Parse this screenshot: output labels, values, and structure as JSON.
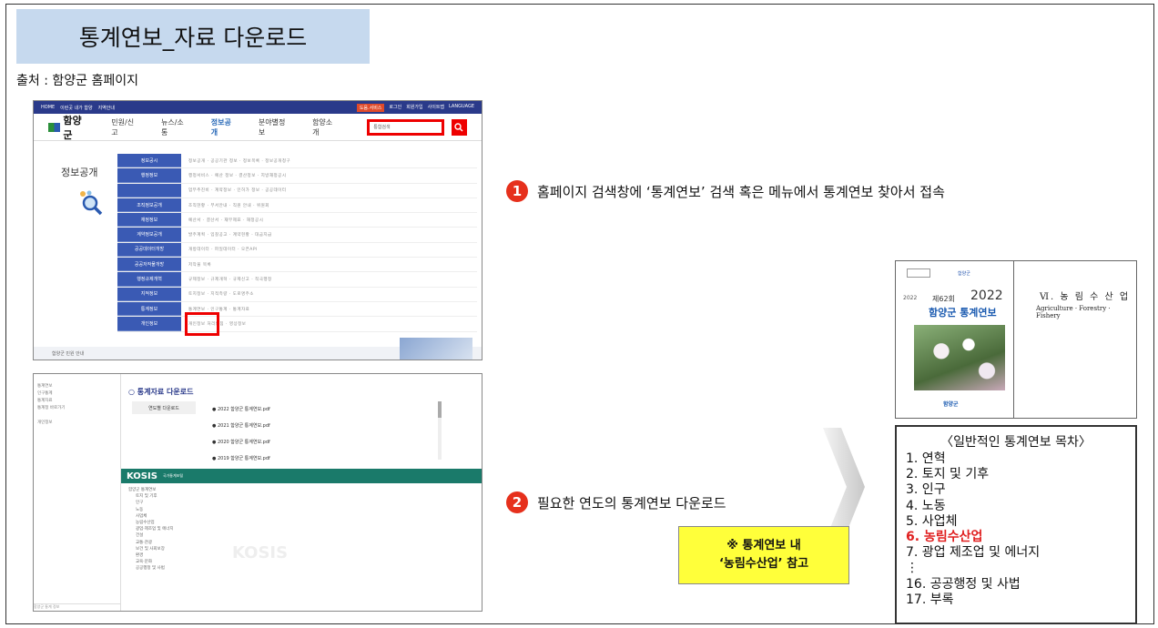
{
  "title": "통계연보_자료 다운로드",
  "source": "출처 : 함양군 홈페이지",
  "homepage": {
    "topbar_left": [
      "HOME",
      "이런곳 내가 함양",
      "지역안내"
    ],
    "topbar_right": [
      "도움.서비스",
      "로그인",
      "회원가입",
      "사이트맵",
      "LANGUAGE"
    ],
    "logo": "함양군",
    "nav": [
      "민원/신고",
      "뉴스/소통",
      "정보공개",
      "분야별정보",
      "함양소개"
    ],
    "active_nav": "정보공개",
    "search_placeholder": "통합검색",
    "search_icon": "search-icon",
    "side_title": "정보공개",
    "menu": [
      {
        "key": "정보공시",
        "val": "정보공개 · 공공기관 정보 · 정보목록 · 정보공개청구"
      },
      {
        "key": "행정정보",
        "val": "행정서비스 · 예산 정보 · 결산정보 · 지방재정공시"
      },
      {
        "key": "",
        "val": "업무추진비 · 계약정보 · 인허가 정보 · 공공데이터"
      },
      {
        "key": "조직정보공개",
        "val": "조직현황 · 부서안내 · 직원 안내 · 위원회"
      },
      {
        "key": "재정정보",
        "val": "예산서 · 결산서 · 재무제표 · 재정공시"
      },
      {
        "key": "계약정보공개",
        "val": "발주계획 · 입찰공고 · 계약현황 · 대금지급"
      },
      {
        "key": "공공데이터개방",
        "val": "개방데이터 · 파일데이터 · 오픈API"
      },
      {
        "key": "공공저작물개방",
        "val": "저작물 목록"
      },
      {
        "key": "행정규제개혁",
        "val": "규제정보 · 규제개혁 · 규제신고 · 적극행정"
      },
      {
        "key": "지적정보",
        "val": "토지정보 · 지적측량 · 도로명주소"
      },
      {
        "key": "통계정보",
        "val": "통계연보 · 인구통계 · 통계자료"
      },
      {
        "key": "개인정보",
        "val": "개인정보 처리방침 · 영상정보"
      }
    ],
    "bottom_notice": "함양군 민원 안내"
  },
  "download_page": {
    "heading": "○ 통계자료 다운로드",
    "year_label": "연도별 다운로드",
    "files": [
      "2022 함양군 통계연보.pdf",
      "2021 함양군 통계연보.pdf",
      "2020 함양군 통계연보.pdf",
      "2019 함양군 통계연보.pdf"
    ],
    "kosis_logo": "KOSIS",
    "kosis_sub": "국가통계포털",
    "kosis_tree": [
      "함양군 통계연보",
      "토지 및 기후",
      "인구",
      "노동",
      "사업체",
      "농림수산업",
      "광업·제조업 및 에너지",
      "건설",
      "교통·관광",
      "보건 및 사회보장",
      "환경",
      "교육·문화",
      "공공행정 및 사법"
    ],
    "left_menu": [
      "통계연보",
      "인구통계",
      "통계자료",
      "통계청 바로가기",
      "개인정보"
    ],
    "footer": "함양군 통계 정보"
  },
  "steps": [
    {
      "num": "1",
      "text": "홈페이지 검색창에 ‘통계연보’ 검색 혹은 메뉴에서 통계연보 찾아서 접속"
    },
    {
      "num": "2",
      "text": "필요한 연도의 통계연보 다운로드"
    }
  ],
  "note": {
    "line1": "※ 통계연보 내",
    "line2": "‘농림수산업’ 참고"
  },
  "book": {
    "edition": "제62회",
    "year": "2022",
    "title": "함양군 통계연보",
    "vertical": "2022",
    "bottom_logo": "함양군",
    "chapter": "Ⅵ. 농 림 수 산 업",
    "chapter_en": "Agriculture · Forestry · Fishery"
  },
  "toc": {
    "title": "〈일반적인 통계연보 목차〉",
    "items": [
      "1. 연혁",
      "2. 토지 및 기후",
      "3. 인구",
      "4. 노동",
      "5. 사업체",
      "6. 농림수산업",
      "7. 광업 제조업 및 에너지",
      "⋮",
      "16. 공공행정 및 사법",
      "17. 부록"
    ],
    "highlight_index": 5,
    "highlight_color": "#e02020"
  },
  "colors": {
    "accent": "#e6301c",
    "title_bg": "#c6d9ee",
    "note_bg": "#ffff3a"
  }
}
